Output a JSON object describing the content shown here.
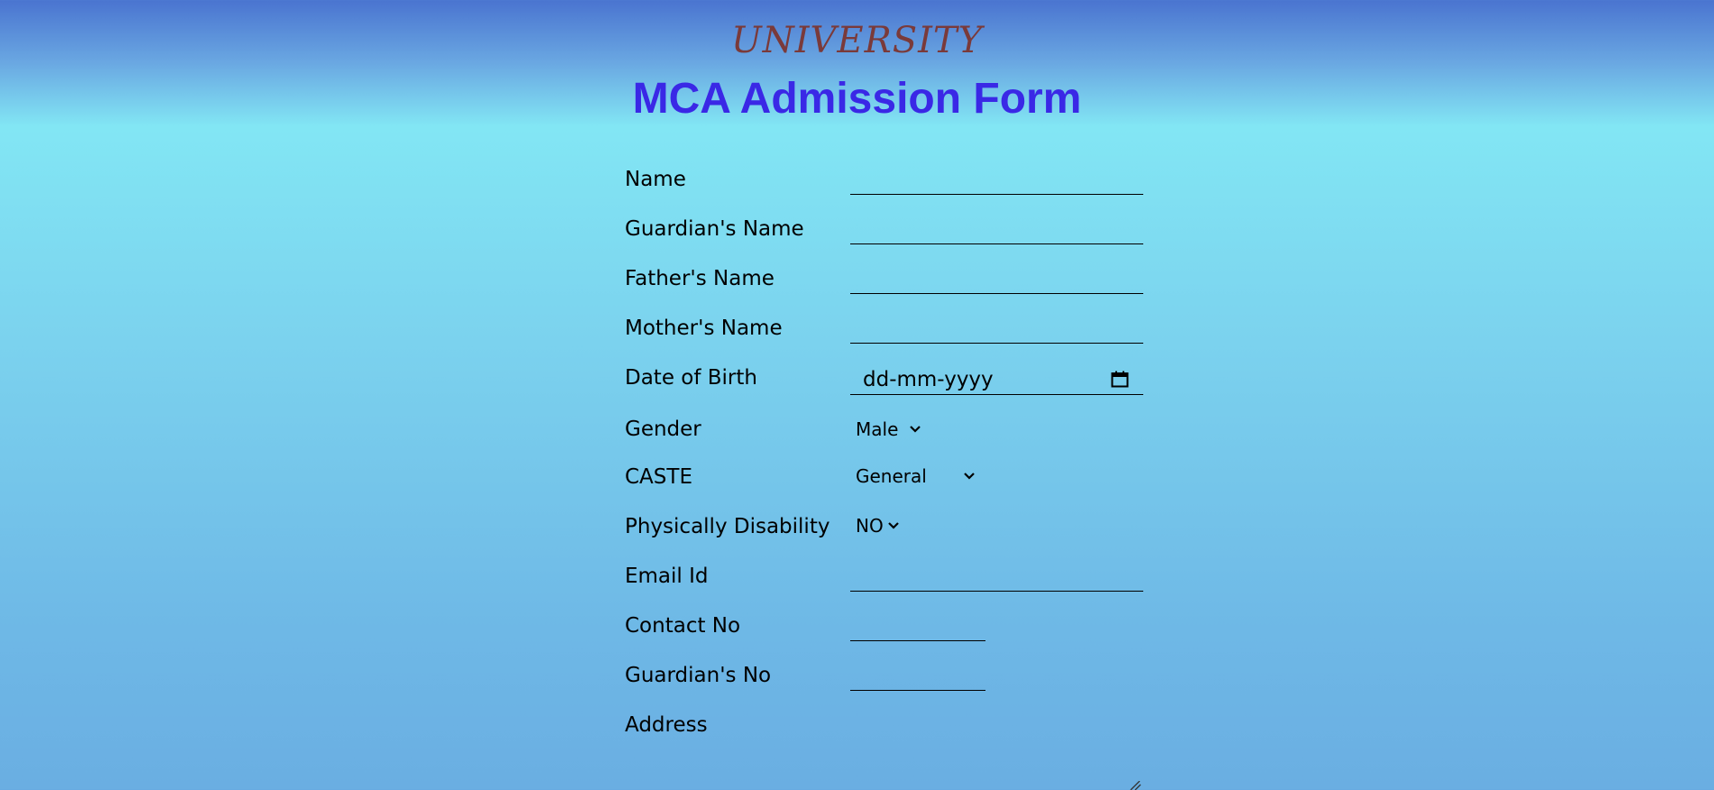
{
  "header": {
    "brand": "UNIVERSITY",
    "title": "MCA Admission Form"
  },
  "form": {
    "name": {
      "label": "Name",
      "value": ""
    },
    "guardian_name": {
      "label": "Guardian's Name",
      "value": ""
    },
    "father_name": {
      "label": "Father's Name",
      "value": ""
    },
    "mother_name": {
      "label": "Mother's Name",
      "value": ""
    },
    "dob": {
      "label": "Date of Birth",
      "placeholder": "dd-mm-yyyy",
      "icon": "calendar-icon"
    },
    "gender": {
      "label": "Gender",
      "selected": "Male"
    },
    "caste": {
      "label": "CASTE",
      "selected": "General"
    },
    "disability": {
      "label": "Physically Disability",
      "selected": "NO"
    },
    "email": {
      "label": "Email Id",
      "value": ""
    },
    "contact": {
      "label": "Contact No",
      "value": ""
    },
    "guardian_no": {
      "label": "Guardian's No",
      "value": ""
    },
    "address": {
      "label": "Address",
      "value": ""
    }
  },
  "colors": {
    "title": "#3a28e6",
    "brand": "#7a3a3a",
    "background_top": "#4a74d0",
    "background_main": "#82e6f4"
  }
}
